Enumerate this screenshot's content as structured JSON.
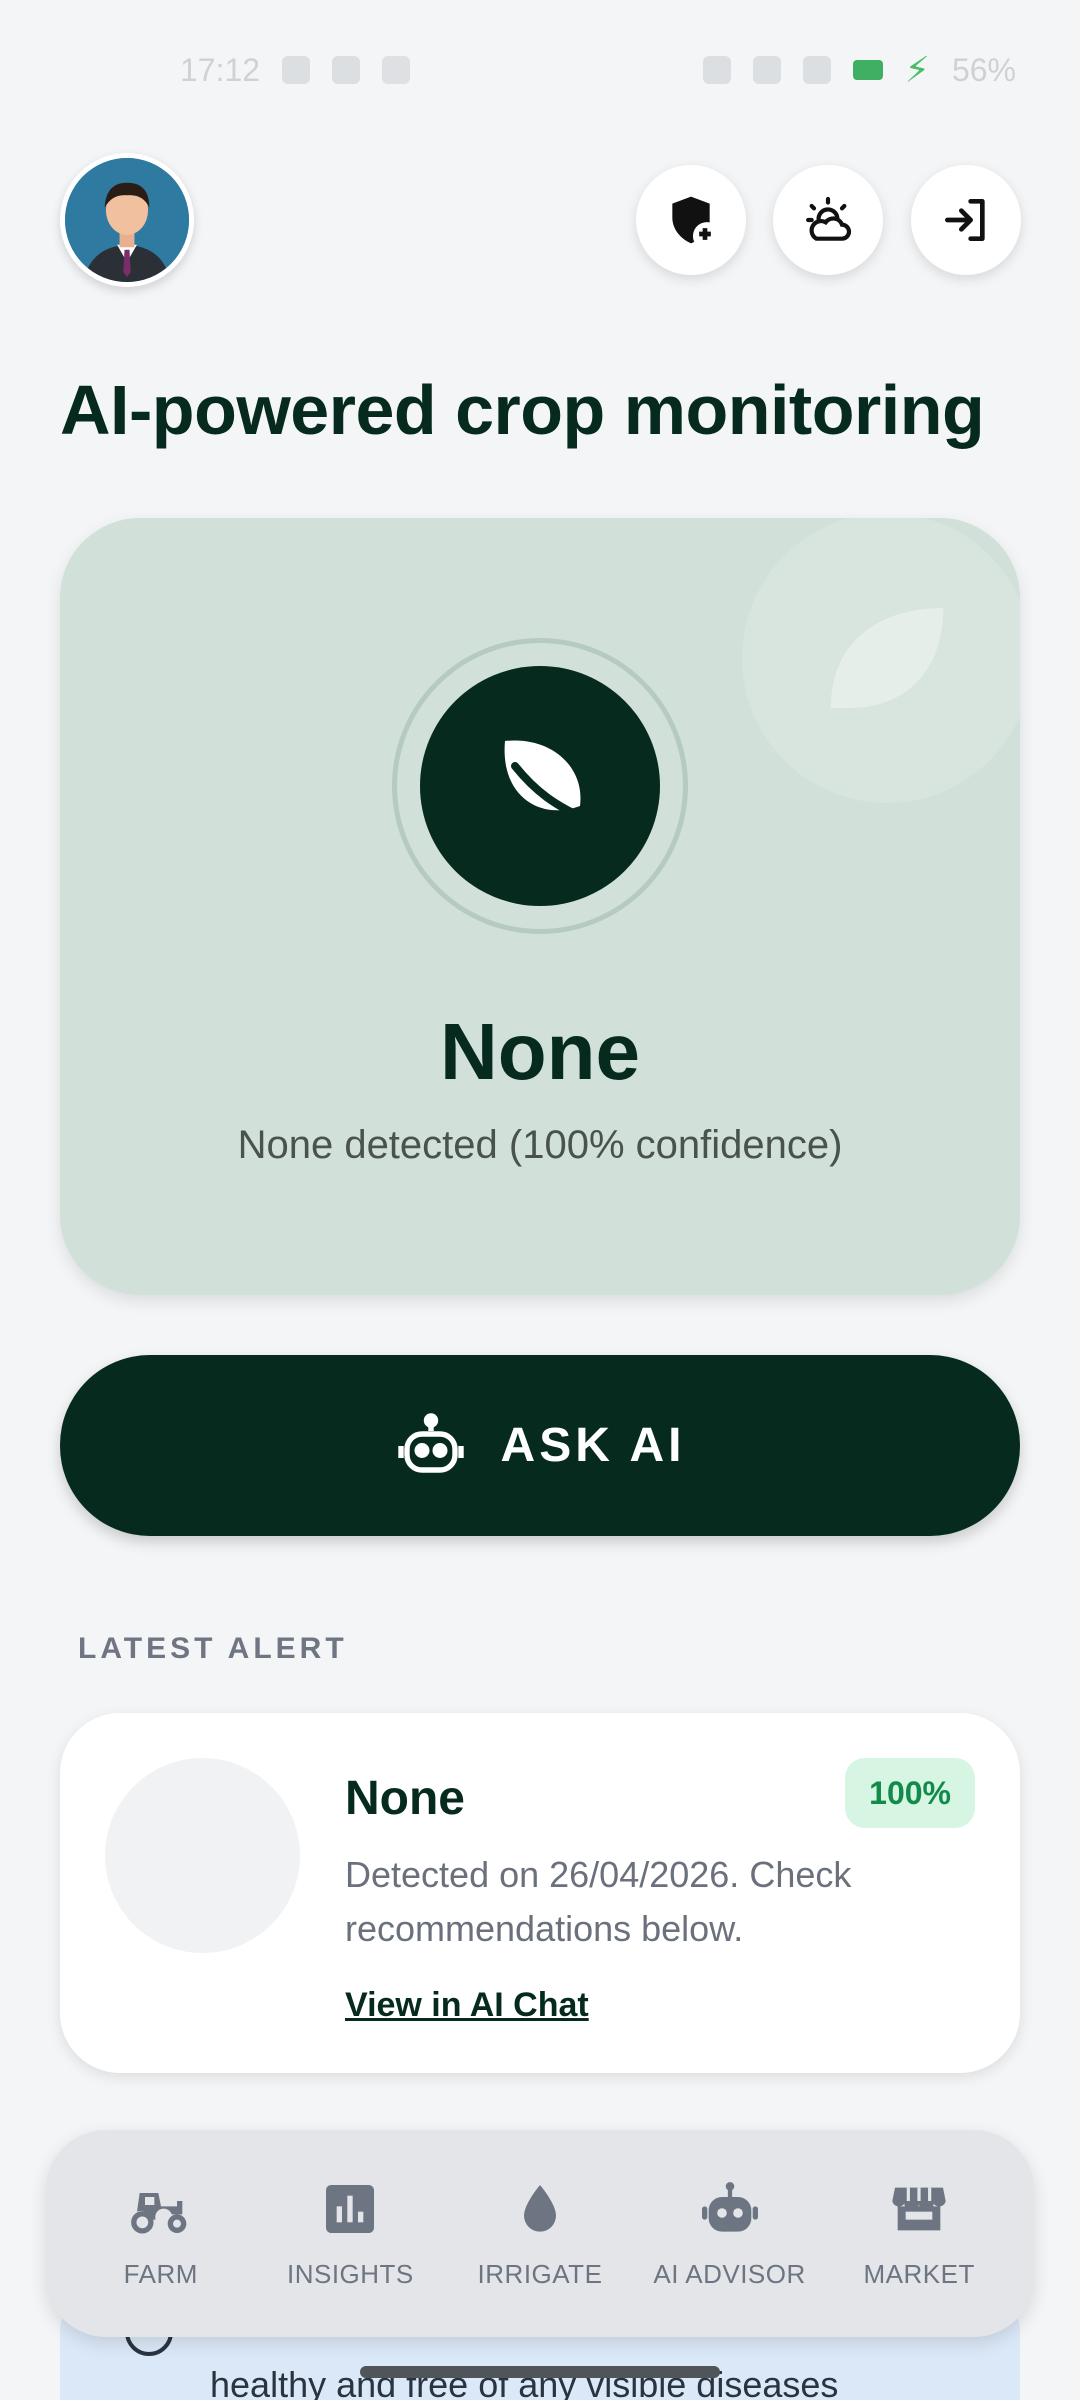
{
  "status_bar": {
    "time": "17:12",
    "battery": "56%"
  },
  "header": {
    "avatar_alt": "profile",
    "actions": [
      {
        "icon": "shield-plus-icon"
      },
      {
        "icon": "weather-icon"
      },
      {
        "icon": "login-icon"
      }
    ]
  },
  "page_title": "AI-powered crop monitoring",
  "detection": {
    "name": "None",
    "subtitle": "None detected (100% confidence)"
  },
  "ask_ai": {
    "label": "ASK AI"
  },
  "latest_alert": {
    "section_label": "LATEST ALERT",
    "title": "None",
    "confidence": "100%",
    "description": "Detected on 26/04/2026. Check recommendations below.",
    "link": "View in AI Chat"
  },
  "info_peek": {
    "text": "healthy and free of any visible diseases"
  },
  "nav": {
    "items": [
      {
        "label": "FARM",
        "icon": "tractor-icon"
      },
      {
        "label": "INSIGHTS",
        "icon": "insights-icon"
      },
      {
        "label": "IRRIGATE",
        "icon": "water-drop-icon"
      },
      {
        "label": "AI ADVISOR",
        "icon": "robot-icon"
      },
      {
        "label": "MARKET",
        "icon": "store-icon"
      }
    ]
  },
  "colors": {
    "primary": "#062b1e",
    "card_bg": "#d1e0d8",
    "badge_bg": "#d6f5e2",
    "badge_text": "#118a4a"
  }
}
